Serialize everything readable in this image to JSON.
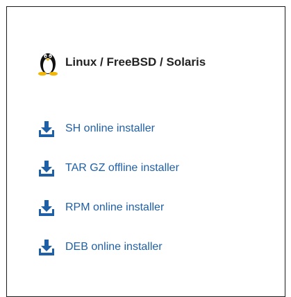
{
  "section": {
    "title": "Linux / FreeBSD / Solaris",
    "icon": "tux-penguin-icon"
  },
  "downloads": [
    {
      "label": "SH online installer",
      "icon": "download-icon"
    },
    {
      "label": "TAR GZ offline installer",
      "icon": "download-icon"
    },
    {
      "label": "RPM online installer",
      "icon": "download-icon"
    },
    {
      "label": "DEB online installer",
      "icon": "download-icon"
    }
  ],
  "colors": {
    "link": "#1f5fa6",
    "icon": "#1f5fa6",
    "heading": "#222222"
  }
}
